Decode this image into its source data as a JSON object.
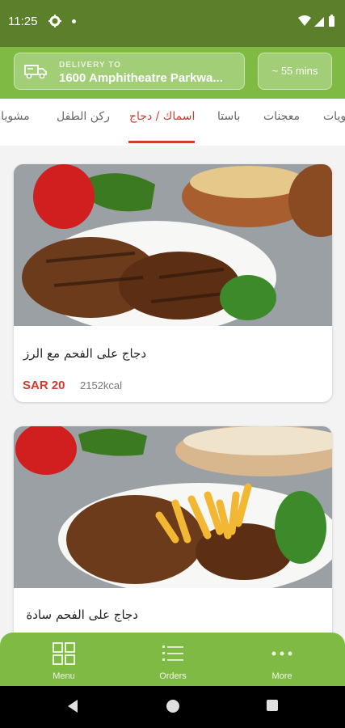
{
  "status_bar": {
    "time": "11:25"
  },
  "delivery": {
    "label": "DELIVERY TO",
    "address": "1600 Amphitheatre Parkwa...",
    "eta": "~ 55 mins"
  },
  "tabs": [
    {
      "label": "مشويات"
    },
    {
      "label": "ركن الطفل"
    },
    {
      "label": "اسماك / دجاج",
      "active": true
    },
    {
      "label": "باستا"
    },
    {
      "label": "معجنات"
    },
    {
      "label": "حلويات"
    }
  ],
  "products": [
    {
      "name": "دجاج على الفحم مع الرز",
      "price": "SAR 20",
      "calories": "2152kcal"
    },
    {
      "name": "دجاج على الفحم سادة"
    }
  ],
  "bottom_nav": [
    {
      "label": "Menu",
      "icon": "grid-icon"
    },
    {
      "label": "Orders",
      "icon": "list-icon"
    },
    {
      "label": "More",
      "icon": "more-dots-icon"
    }
  ],
  "colors": {
    "header_green": "#7fbb44",
    "status_green": "#5b7f2a",
    "accent_red": "#d33a2c"
  }
}
